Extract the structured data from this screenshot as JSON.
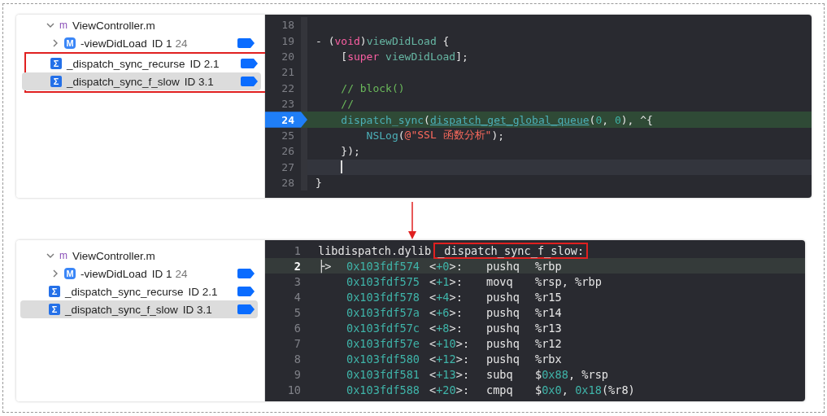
{
  "top_panel": {
    "navigator": {
      "items": [
        {
          "label": "ViewController.m",
          "kind": "file",
          "badge": "m",
          "expanded": true,
          "selected": false,
          "highlighted": false,
          "children": [
            {
              "label": "-viewDidLoad",
              "id": "ID 1",
              "line": "24",
              "kind": "method",
              "badge": "M",
              "expanded": false,
              "breakpoint": true,
              "selected": false,
              "highlighted": false
            },
            {
              "label": "_dispatch_sync_recurse",
              "id": "ID 2.1",
              "kind": "symbol",
              "badge": "Σ",
              "breakpoint": true,
              "selected": false,
              "highlighted": true
            },
            {
              "label": "_dispatch_sync_f_slow",
              "id": "ID 3.1",
              "kind": "symbol",
              "badge": "Σ",
              "breakpoint": true,
              "selected": true,
              "highlighted": true
            }
          ]
        }
      ]
    },
    "editor": {
      "lines": [
        {
          "no": "18",
          "current": false,
          "cursor": false,
          "breakpoint": false
        },
        {
          "no": "19",
          "tokens": [
            {
              "kind": "p",
              "text": "- ("
            },
            {
              "kind": "kw",
              "text": "void"
            },
            {
              "kind": "p",
              "text": ")"
            },
            {
              "kind": "fn",
              "text": "viewDidLoad"
            },
            {
              "kind": "p",
              "text": " {"
            }
          ],
          "current": false,
          "cursor": false,
          "breakpoint": false
        },
        {
          "no": "20",
          "tokens": [
            {
              "kind": "p",
              "text": "    ["
            },
            {
              "kind": "kw",
              "text": "super"
            },
            {
              "kind": "fn",
              "text": " viewDidLoad"
            },
            {
              "kind": "p",
              "text": "];"
            }
          ],
          "current": false,
          "cursor": false,
          "breakpoint": false
        },
        {
          "no": "21",
          "current": false,
          "cursor": false,
          "breakpoint": false
        },
        {
          "no": "22",
          "tokens": [
            {
              "kind": "cm",
              "text": "    // block()"
            }
          ],
          "current": false,
          "cursor": false,
          "breakpoint": false
        },
        {
          "no": "23",
          "tokens": [
            {
              "kind": "cm",
              "text": "    //"
            }
          ],
          "current": false,
          "cursor": false,
          "breakpoint": false
        },
        {
          "no": "24",
          "tokens": [
            {
              "kind": "call",
              "text": "    dispatch_sync"
            },
            {
              "kind": "p",
              "text": "("
            },
            {
              "kind": "link",
              "text": "dispatch_get_global_queue"
            },
            {
              "kind": "p",
              "text": "("
            },
            {
              "kind": "num",
              "text": "0"
            },
            {
              "kind": "p",
              "text": ", "
            },
            {
              "kind": "num",
              "text": "0"
            },
            {
              "kind": "p",
              "text": "), ^{"
            }
          ],
          "current": true,
          "cursor": false,
          "breakpoint": true
        },
        {
          "no": "25",
          "tokens": [
            {
              "kind": "call",
              "text": "        NSLog"
            },
            {
              "kind": "p",
              "text": "("
            },
            {
              "kind": "str",
              "text": "@\"SSL 函数分析\""
            },
            {
              "kind": "p",
              "text": ");"
            }
          ],
          "current": false,
          "cursor": false,
          "breakpoint": false
        },
        {
          "no": "26",
          "tokens": [
            {
              "kind": "p",
              "text": "    });"
            }
          ],
          "current": false,
          "cursor": false,
          "breakpoint": false
        },
        {
          "no": "27",
          "current": false,
          "cursor": true,
          "breakpoint": false
        },
        {
          "no": "28",
          "tokens": [
            {
              "kind": "p",
              "text": "}"
            }
          ],
          "current": false,
          "cursor": false,
          "breakpoint": false
        }
      ]
    }
  },
  "bottom_panel": {
    "navigator": {
      "items": [
        {
          "label": "ViewController.m",
          "kind": "file",
          "badge": "m",
          "expanded": true,
          "selected": false,
          "highlighted": false,
          "children": [
            {
              "label": "-viewDidLoad",
              "id": "ID 1",
              "line": "24",
              "kind": "method",
              "badge": "M",
              "expanded": false,
              "breakpoint": true,
              "selected": false,
              "highlighted": false
            },
            {
              "label": "_dispatch_sync_recurse",
              "id": "ID 2.1",
              "kind": "symbol",
              "badge": "Σ",
              "breakpoint": true,
              "selected": false,
              "highlighted": false
            },
            {
              "label": "_dispatch_sync_f_slow",
              "id": "ID 3.1",
              "kind": "symbol",
              "badge": "Σ",
              "breakpoint": true,
              "selected": true,
              "highlighted": false
            }
          ]
        }
      ]
    },
    "disassembly": {
      "rows": [
        {
          "kind": "header",
          "no": "1",
          "module": "libdispatch.dylib",
          "symbol": "_dispatch_sync_f_slow:",
          "highlighted": true,
          "current": false
        },
        {
          "kind": "instr",
          "no": "2",
          "pointer": "├>",
          "address": "0x103fdf574",
          "offset": [
            {
              "kind": "p",
              "text": "<"
            },
            {
              "kind": "num",
              "text": "+0"
            },
            {
              "kind": "p",
              "text": ">:"
            }
          ],
          "mnemonic": "pushq",
          "operands": [
            {
              "kind": "p",
              "text": "%rbp"
            }
          ],
          "current": true
        },
        {
          "kind": "instr",
          "no": "3",
          "address": "0x103fdf575",
          "offset": [
            {
              "kind": "p",
              "text": "<"
            },
            {
              "kind": "num",
              "text": "+1"
            },
            {
              "kind": "p",
              "text": ">:"
            }
          ],
          "mnemonic": "movq",
          "operands": [
            {
              "kind": "p",
              "text": "%rsp, %rbp"
            }
          ],
          "current": false
        },
        {
          "kind": "instr",
          "no": "4",
          "address": "0x103fdf578",
          "offset": [
            {
              "kind": "p",
              "text": "<"
            },
            {
              "kind": "num",
              "text": "+4"
            },
            {
              "kind": "p",
              "text": ">:"
            }
          ],
          "mnemonic": "pushq",
          "operands": [
            {
              "kind": "p",
              "text": "%r15"
            }
          ],
          "current": false
        },
        {
          "kind": "instr",
          "no": "5",
          "address": "0x103fdf57a",
          "offset": [
            {
              "kind": "p",
              "text": "<"
            },
            {
              "kind": "num",
              "text": "+6"
            },
            {
              "kind": "p",
              "text": ">:"
            }
          ],
          "mnemonic": "pushq",
          "operands": [
            {
              "kind": "p",
              "text": "%r14"
            }
          ],
          "current": false
        },
        {
          "kind": "instr",
          "no": "6",
          "address": "0x103fdf57c",
          "offset": [
            {
              "kind": "p",
              "text": "<"
            },
            {
              "kind": "num",
              "text": "+8"
            },
            {
              "kind": "p",
              "text": ">:"
            }
          ],
          "mnemonic": "pushq",
          "operands": [
            {
              "kind": "p",
              "text": "%r13"
            }
          ],
          "current": false
        },
        {
          "kind": "instr",
          "no": "7",
          "address": "0x103fdf57e",
          "offset": [
            {
              "kind": "p",
              "text": "<"
            },
            {
              "kind": "num",
              "text": "+10"
            },
            {
              "kind": "p",
              "text": ">:"
            }
          ],
          "mnemonic": "pushq",
          "operands": [
            {
              "kind": "p",
              "text": "%r12"
            }
          ],
          "current": false
        },
        {
          "kind": "instr",
          "no": "8",
          "address": "0x103fdf580",
          "offset": [
            {
              "kind": "p",
              "text": "<"
            },
            {
              "kind": "num",
              "text": "+12"
            },
            {
              "kind": "p",
              "text": ">:"
            }
          ],
          "mnemonic": "pushq",
          "operands": [
            {
              "kind": "p",
              "text": "%rbx"
            }
          ],
          "current": false
        },
        {
          "kind": "instr",
          "no": "9",
          "address": "0x103fdf581",
          "offset": [
            {
              "kind": "p",
              "text": "<"
            },
            {
              "kind": "num",
              "text": "+13"
            },
            {
              "kind": "p",
              "text": ">:"
            }
          ],
          "mnemonic": "subq",
          "operands": [
            {
              "kind": "p",
              "text": "$"
            },
            {
              "kind": "num",
              "text": "0x88"
            },
            {
              "kind": "p",
              "text": ", %rsp"
            }
          ],
          "current": false
        },
        {
          "kind": "instr",
          "no": "10",
          "address": "0x103fdf588",
          "offset": [
            {
              "kind": "p",
              "text": "<"
            },
            {
              "kind": "num",
              "text": "+20"
            },
            {
              "kind": "p",
              "text": ">:"
            }
          ],
          "mnemonic": "cmpq",
          "operands": [
            {
              "kind": "p",
              "text": "$"
            },
            {
              "kind": "num",
              "text": "0x0"
            },
            {
              "kind": "p",
              "text": ", "
            },
            {
              "kind": "num",
              "text": "0x18"
            },
            {
              "kind": "p",
              "text": "(%r8)"
            }
          ],
          "current": false
        }
      ]
    }
  }
}
